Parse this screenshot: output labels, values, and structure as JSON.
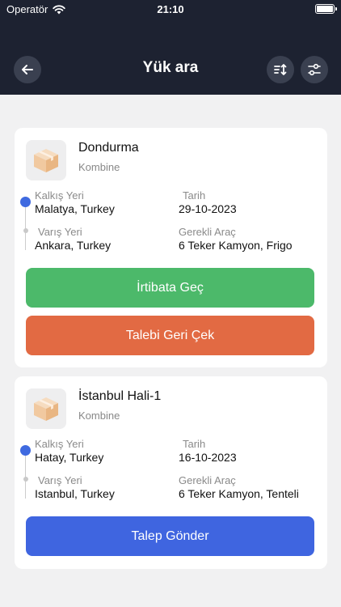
{
  "status_bar": {
    "carrier": "Operatör",
    "time": "21:10"
  },
  "header": {
    "title": "Yük ara"
  },
  "icons": {
    "back": "arrow-left-icon",
    "sort": "sort-icon",
    "filter": "sliders-icon",
    "thumb": "box-icon"
  },
  "colors": {
    "header_bg": "#1d2231",
    "accent_blue": "#3f65e0",
    "green": "#4cb96a",
    "orange": "#e26a43"
  },
  "cards": [
    {
      "title": "Dondurma",
      "subtitle": "Kombine",
      "from_label": "Kalkış Yeri",
      "from_value": "Malatya, Turkey",
      "to_label": "Varış Yeri",
      "to_value": "Ankara, Turkey",
      "date_label": "Tarih",
      "date_value": "29-10-2023",
      "vehicle_label": "Gerekli Araç",
      "vehicle_value": "6 Teker Kamyon, Frigo",
      "buttons": [
        "İrtibata Geç",
        "Talebi Geri Çek"
      ]
    },
    {
      "title": "İstanbul Hali-1",
      "subtitle": "Kombine",
      "from_label": "Kalkış Yeri",
      "from_value": "Hatay, Turkey",
      "to_label": "Varış Yeri",
      "to_value": "Istanbul, Turkey",
      "date_label": "Tarih",
      "date_value": "16-10-2023",
      "vehicle_label": "Gerekli Araç",
      "vehicle_value": "6 Teker Kamyon, Tenteli",
      "buttons": [
        "Talep Gönder"
      ]
    }
  ]
}
